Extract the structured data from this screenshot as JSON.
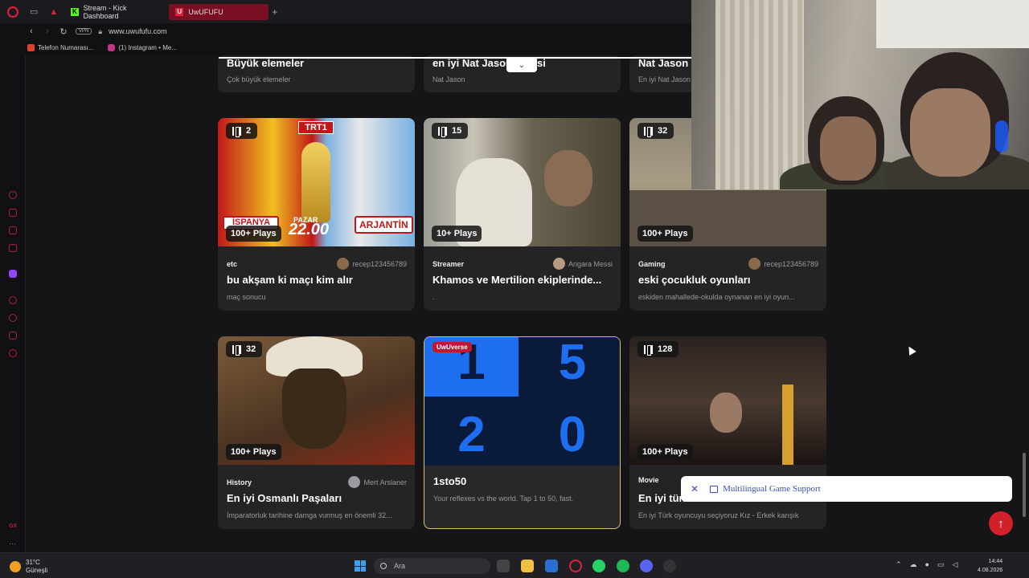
{
  "browser": {
    "tabs": [
      {
        "label": "Stream - Kick Dashboard",
        "active": false
      },
      {
        "label": "UwUFUFU",
        "active": true
      }
    ],
    "url": "www.uwufufu.com",
    "vpn_label": "VPN",
    "bookmarks": [
      {
        "label": "Telefon Numarası..."
      },
      {
        "label": "(1) Instagram • Me..."
      }
    ]
  },
  "top_cards": [
    {
      "title": "Büyük elemeler",
      "desc": "Çok büyük elemeler"
    },
    {
      "title": "en iyi Nat Jason … kisi",
      "desc": "Nat Jason"
    },
    {
      "title": "Nat Jason",
      "desc": "En iyi Nat Jason"
    }
  ],
  "cards": [
    {
      "count": "2",
      "plays": "100+ Plays",
      "category": "etc",
      "author": "recep123456789",
      "title": "bu akşam ki maçı kim alır",
      "desc": "maç sonucu"
    },
    {
      "count": "15",
      "plays": "10+ Plays",
      "category": "Streamer",
      "author": "Angara Messi",
      "title": "Khamos ve Mertilion ekiplerinde...",
      "desc": "."
    },
    {
      "count": "32",
      "plays": "100+ Plays",
      "category": "Gaming",
      "author": "recep123456789",
      "title": "eski çocukluk oyunları",
      "desc": "eskiden mahallede-okulda oynanan en iyi oyun..."
    },
    {
      "count": "32",
      "plays": "100+ Plays",
      "category": "History",
      "author": "Mert Arslaner",
      "title": "En iyi Osmanlı Paşaları",
      "desc": "İmparatorluk tarihine damga vurmuş en önemli 32..."
    },
    {
      "badge": "UwUverse",
      "title": "1sto50",
      "desc": "Your reflexes vs the world. Tap 1 to 50, fast.",
      "grid_numbers": [
        "1",
        "5",
        "2",
        "0"
      ]
    },
    {
      "count": "128",
      "plays": "100+ Plays",
      "category": "Movie",
      "title": "En iyi tür...",
      "desc": "En iyi Türk oyuncuyu seçiyoruz Kız - Erkek karışık"
    }
  ],
  "thumb_text": {
    "trt": "TRT1",
    "pazar": "PAZAR",
    "time": "22.00",
    "team_right": "ARJANTİN",
    "team_left": "İSPANYA"
  },
  "notice": {
    "label": "Multilingual Game Support"
  },
  "taskbar": {
    "weather_temp": "31°C",
    "weather_desc": "Güneşli",
    "search_placeholder": "Ara",
    "time": "14:44",
    "date": "4.08.2026"
  },
  "colors": {
    "accent": "#e0203a",
    "featured_border": "#d9c46a",
    "scroll_top_button": "#d1202a"
  }
}
